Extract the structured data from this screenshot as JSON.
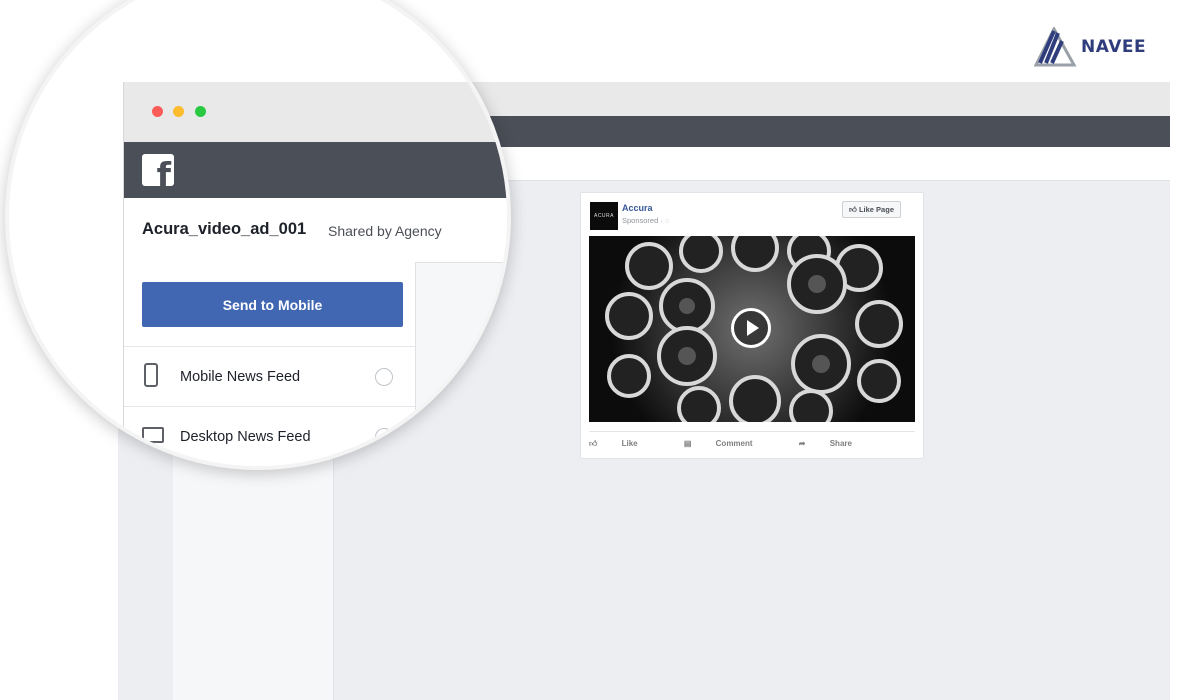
{
  "brand": {
    "logo_text": "NAVEE",
    "accent_color": "#2f3d7d"
  },
  "window": {
    "title_bar_dots": [
      "red",
      "yellow",
      "green"
    ],
    "facebook_logo": "f"
  },
  "preview": {
    "ad_name": "Acura_video_ad_001",
    "shared_by": "Shared by Agency",
    "send_button_label": "Send to Mobile",
    "placements": [
      {
        "label": "Mobile News Feed",
        "icon": "mobile-phone-icon",
        "selected": false
      },
      {
        "label": "Desktop News Feed",
        "icon": "desktop-monitor-icon",
        "selected": false
      }
    ]
  },
  "ad": {
    "logo_text": "ACURA",
    "page_name": "Accura",
    "sponsored": "Sponsored · ◌",
    "like_page_label": "Like Page",
    "media_type": "video",
    "play_icon": "play-icon",
    "actions": [
      {
        "label": "Like",
        "icon": "thumbs-up-icon"
      },
      {
        "label": "Comment",
        "icon": "comment-icon"
      },
      {
        "label": "Share",
        "icon": "share-icon"
      }
    ]
  },
  "colors": {
    "facebook_bar": "#4b4f58",
    "send_button": "#4267b2",
    "page_link": "#365899"
  }
}
